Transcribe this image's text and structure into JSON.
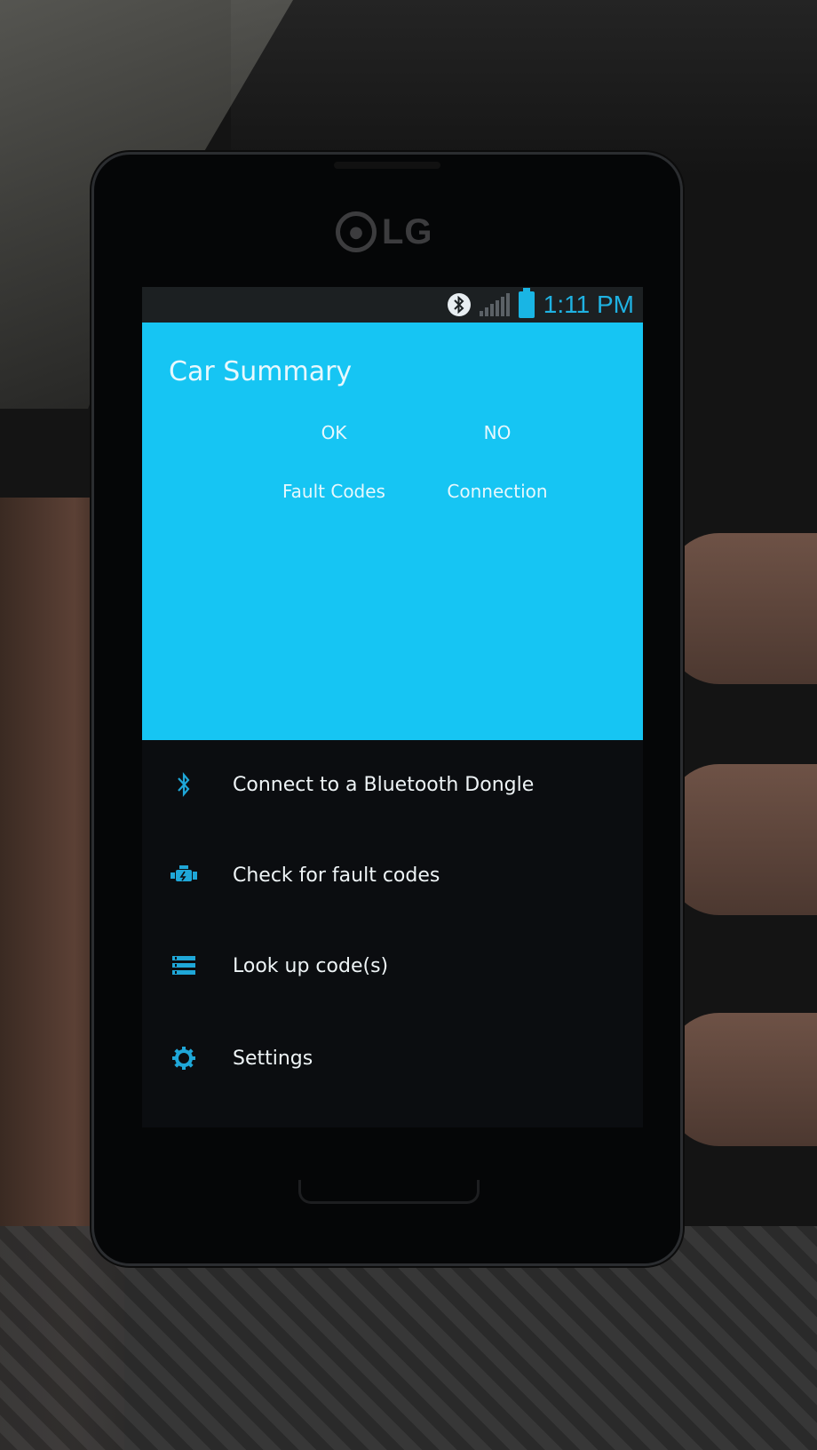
{
  "device": {
    "brand": "LG"
  },
  "status_bar": {
    "time": "1:11 PM",
    "icons": [
      "bluetooth-icon",
      "signal-icon",
      "battery-icon"
    ]
  },
  "summary": {
    "title": "Car Summary",
    "stats": [
      {
        "value": "OK",
        "label": "Fault Codes"
      },
      {
        "value": "NO",
        "label": "Connection"
      }
    ]
  },
  "menu": {
    "items": [
      {
        "icon": "bluetooth-icon",
        "label": "Connect to a Bluetooth Dongle"
      },
      {
        "icon": "engine-icon",
        "label": "Check for fault codes"
      },
      {
        "icon": "list-icon",
        "label": "Look up code(s)"
      },
      {
        "icon": "gear-icon",
        "label": "Settings"
      }
    ]
  },
  "colors": {
    "accent": "#16c5f3",
    "icon": "#1fa7d8",
    "background": "#0b0d10"
  }
}
